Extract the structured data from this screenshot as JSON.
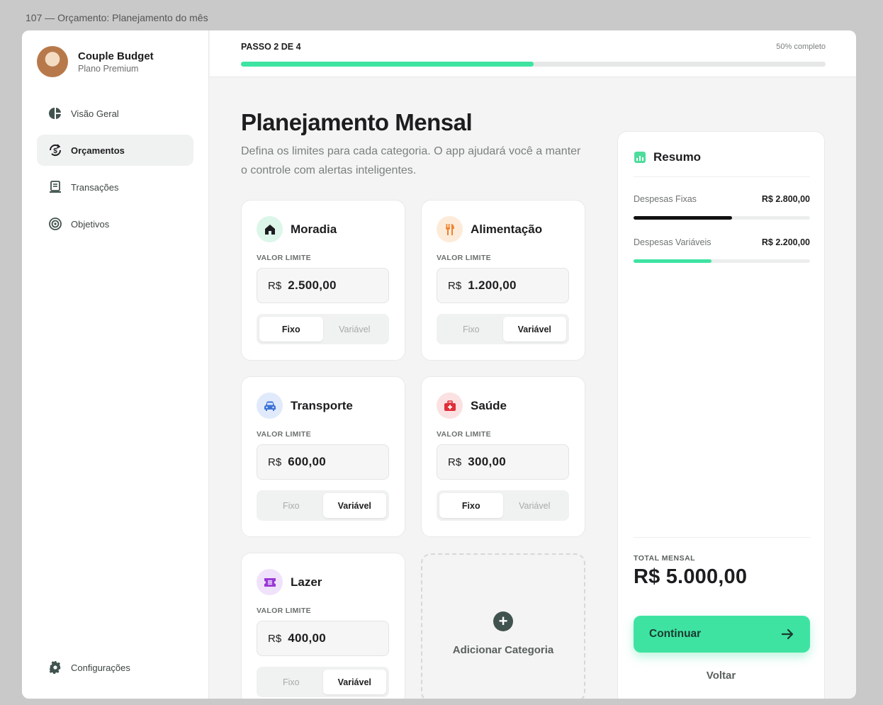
{
  "window_title": "107 — Orçamento: Planejamento do mês",
  "brand": {
    "name": "Couple Budget",
    "plan": "Plano Premium"
  },
  "nav": {
    "items": [
      {
        "label": "Visão Geral",
        "icon": "pie-chart-icon"
      },
      {
        "label": "Orçamentos",
        "icon": "budget-refresh-icon",
        "active": true
      },
      {
        "label": "Transações",
        "icon": "receipt-icon"
      },
      {
        "label": "Objetivos",
        "icon": "target-icon"
      }
    ],
    "settings": {
      "label": "Configurações",
      "icon": "gear-icon"
    }
  },
  "progress": {
    "step_label": "PASSO 2 DE 4",
    "percent_label": "50% completo",
    "value": 0.5,
    "color": "#3ee3a2"
  },
  "header": {
    "title": "Planejamento Mensal",
    "description": "Defina os limites para cada categoria. O app ajudará você a manter o controle com alertas inteligentes."
  },
  "limit_label": "VALOR LIMITE",
  "currency": "R$",
  "toggle_labels": {
    "fixed": "Fixo",
    "variable": "Variável"
  },
  "categories": [
    {
      "name": "Moradia",
      "amount": "2.500,00",
      "type": "fixed",
      "icon": "home-icon",
      "color": "#1d1d1f",
      "bg": "#dcf6ea"
    },
    {
      "name": "Alimentação",
      "amount": "1.200,00",
      "type": "variable",
      "icon": "fork-knife-icon",
      "color": "#f0812e",
      "bg": "#fdebd9"
    },
    {
      "name": "Transporte",
      "amount": "600,00",
      "type": "variable",
      "icon": "car-icon",
      "color": "#3c73d8",
      "bg": "#e0eafb"
    },
    {
      "name": "Saúde",
      "amount": "300,00",
      "type": "fixed",
      "icon": "medical-kit-icon",
      "color": "#e02f3a",
      "bg": "#fbe1e2"
    },
    {
      "name": "Lazer",
      "amount": "400,00",
      "type": "variable",
      "icon": "ticket-icon",
      "color": "#9b38d6",
      "bg": "#f0e2fb"
    }
  ],
  "add_category": {
    "label": "Adicionar Categoria",
    "icon": "plus-circle-icon"
  },
  "summary": {
    "title": "Resumo",
    "icon": "bar-chart-icon",
    "rows": [
      {
        "label": "Despesas Fixas",
        "value": "R$ 2.800,00",
        "fraction": 0.56,
        "color": "#111111"
      },
      {
        "label": "Despesas Variáveis",
        "value": "R$ 2.200,00",
        "fraction": 0.44,
        "color": "#3ee3a2"
      }
    ],
    "total_label": "TOTAL MENSAL",
    "total_value": "R$ 5.000,00",
    "continue_label": "Continuar",
    "back_label": "Voltar"
  }
}
